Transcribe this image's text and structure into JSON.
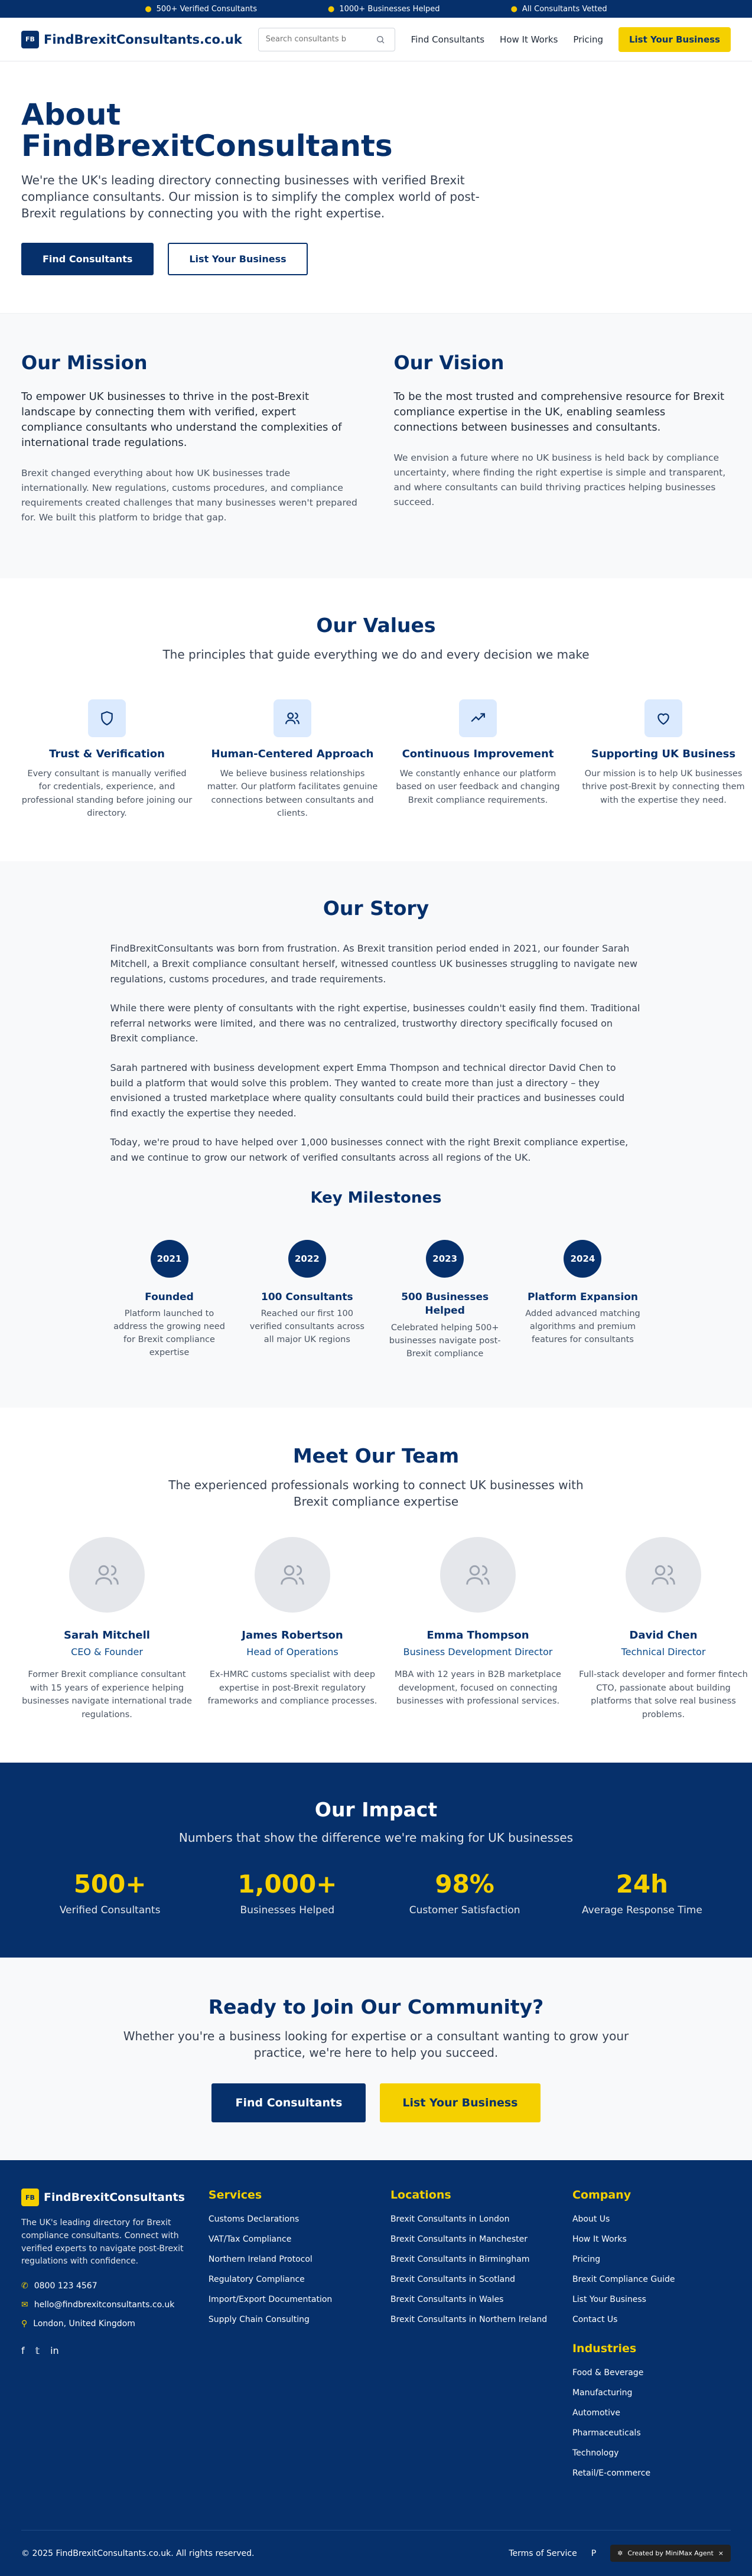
{
  "topbar": {
    "items": [
      "500+ Verified Consultants",
      "1000+ Businesses Helped",
      "All Consultants Vetted"
    ]
  },
  "nav": {
    "logo_badge": "FB",
    "logo_text": "FindBrexitConsultants.co.uk",
    "search_placeholder": "Search consultants b",
    "links": [
      "Find Consultants",
      "How It Works",
      "Pricing"
    ],
    "cta": "List Your Business"
  },
  "hero": {
    "title": "About FindBrexitConsultants",
    "text": "We're the UK's leading directory connecting businesses with verified Brexit compliance consultants. Our mission is to simplify the complex world of post-Brexit regulations by connecting you with the right expertise.",
    "btn_primary": "Find Consultants",
    "btn_secondary": "List Your Business"
  },
  "mission": {
    "title": "Our Mission",
    "lead": "To empower UK businesses to thrive in the post-Brexit landscape by connecting them with verified, expert compliance consultants who understand the complexities of international trade regulations.",
    "sub": "Brexit changed everything about how UK businesses trade internationally. New regulations, customs procedures, and compliance requirements created challenges that many businesses weren't prepared for. We built this platform to bridge that gap."
  },
  "vision": {
    "title": "Our Vision",
    "lead": "To be the most trusted and comprehensive resource for Brexit compliance expertise in the UK, enabling seamless connections between businesses and consultants.",
    "sub": "We envision a future where no UK business is held back by compliance uncertainty, where finding the right expertise is simple and transparent, and where consultants can build thriving practices helping businesses succeed."
  },
  "values": {
    "title": "Our Values",
    "subtitle": "The principles that guide everything we do and every decision we make",
    "items": [
      {
        "title": "Trust & Verification",
        "text": "Every consultant is manually verified for credentials, experience, and professional standing before joining our directory.",
        "icon": "shield-icon"
      },
      {
        "title": "Human-Centered Approach",
        "text": "We believe business relationships matter. Our platform facilitates genuine connections between consultants and clients.",
        "icon": "users-icon"
      },
      {
        "title": "Continuous Improvement",
        "text": "We constantly enhance our platform based on user feedback and changing Brexit compliance requirements.",
        "icon": "trending-up-icon"
      },
      {
        "title": "Supporting UK Business",
        "text": "Our mission is to help UK businesses thrive post-Brexit by connecting them with the expertise they need.",
        "icon": "heart-icon"
      }
    ]
  },
  "story": {
    "title": "Our Story",
    "paragraphs": [
      "FindBrexitConsultants was born from frustration. As Brexit transition period ended in 2021, our founder Sarah Mitchell, a Brexit compliance consultant herself, witnessed countless UK businesses struggling to navigate new regulations, customs procedures, and trade requirements.",
      "While there were plenty of consultants with the right expertise, businesses couldn't easily find them. Traditional referral networks were limited, and there was no centralized, trustworthy directory specifically focused on Brexit compliance.",
      "Sarah partnered with business development expert Emma Thompson and technical director David Chen to build a platform that would solve this problem. They wanted to create more than just a directory – they envisioned a trusted marketplace where quality consultants could build their practices and businesses could find exactly the expertise they needed.",
      "Today, we're proud to have helped over 1,000 businesses connect with the right Brexit compliance expertise, and we continue to grow our network of verified consultants across all regions of the UK."
    ],
    "milestones_title": "Key Milestones",
    "milestones": [
      {
        "year": "2021",
        "title": "Founded",
        "text": "Platform launched to address the growing need for Brexit compliance expertise"
      },
      {
        "year": "2022",
        "title": "100 Consultants",
        "text": "Reached our first 100 verified consultants across all major UK regions"
      },
      {
        "year": "2023",
        "title": "500 Businesses Helped",
        "text": "Celebrated helping 500+ businesses navigate post-Brexit compliance"
      },
      {
        "year": "2024",
        "title": "Platform Expansion",
        "text": "Added advanced matching algorithms and premium features for consultants"
      }
    ]
  },
  "team": {
    "title": "Meet Our Team",
    "subtitle": "The experienced professionals working to connect UK businesses with Brexit compliance expertise",
    "members": [
      {
        "name": "Sarah Mitchell",
        "role": "CEO & Founder",
        "bio": "Former Brexit compliance consultant with 15 years of experience helping businesses navigate international trade regulations."
      },
      {
        "name": "James Robertson",
        "role": "Head of Operations",
        "bio": "Ex-HMRC customs specialist with deep expertise in post-Brexit regulatory frameworks and compliance processes."
      },
      {
        "name": "Emma Thompson",
        "role": "Business Development Director",
        "bio": "MBA with 12 years in B2B marketplace development, focused on connecting businesses with professional services."
      },
      {
        "name": "David Chen",
        "role": "Technical Director",
        "bio": "Full-stack developer and former fintech CTO, passionate about building platforms that solve real business problems."
      }
    ]
  },
  "impact": {
    "title": "Our Impact",
    "subtitle": "Numbers that show the difference we're making for UK businesses",
    "stats": [
      {
        "num": "500+",
        "label": "Verified Consultants"
      },
      {
        "num": "1,000+",
        "label": "Businesses Helped"
      },
      {
        "num": "98%",
        "label": "Customer Satisfaction"
      },
      {
        "num": "24h",
        "label": "Average Response Time"
      }
    ]
  },
  "cta": {
    "title": "Ready to Join Our Community?",
    "subtitle": "Whether you're a business looking for expertise or a consultant wanting to grow your practice, we're here to help you succeed.",
    "btn_primary": "Find Consultants",
    "btn_secondary": "List Your Business"
  },
  "footer": {
    "logo_badge": "FB",
    "logo_text": "FindBrexitConsultants",
    "about": "The UK's leading directory for Brexit compliance consultants. Connect with verified experts to navigate post-Brexit regulations with confidence.",
    "phone": "0800 123 4567",
    "email": "hello@findbrexitconsultants.co.uk",
    "location": "London, United Kingdom",
    "services_title": "Services",
    "services": [
      "Customs Declarations",
      "VAT/Tax Compliance",
      "Northern Ireland Protocol",
      "Regulatory Compliance",
      "Import/Export Documentation",
      "Supply Chain Consulting"
    ],
    "locations_title": "Locations",
    "locations": [
      "Brexit Consultants in London",
      "Brexit Consultants in Manchester",
      "Brexit Consultants in Birmingham",
      "Brexit Consultants in Scotland",
      "Brexit Consultants in Wales",
      "Brexit Consultants in Northern Ireland"
    ],
    "company_title": "Company",
    "company": [
      "About Us",
      "How It Works",
      "Pricing",
      "Brexit Compliance Guide",
      "List Your Business",
      "Contact Us"
    ],
    "industries_title": "Industries",
    "industries": [
      "Food & Beverage",
      "Manufacturing",
      "Automotive",
      "Pharmaceuticals",
      "Technology",
      "Retail/E-commerce"
    ],
    "copyright": "© 2025 FindBrexitConsultants.co.uk. All rights reserved.",
    "bottom_links": [
      "Terms of Service",
      "P"
    ],
    "agent_badge": "Created by MiniMax Agent",
    "agent_close": "×"
  },
  "colors": {
    "navy": "#06306b",
    "yellow": "#f5d000",
    "light_bg": "#f8f9fa"
  }
}
